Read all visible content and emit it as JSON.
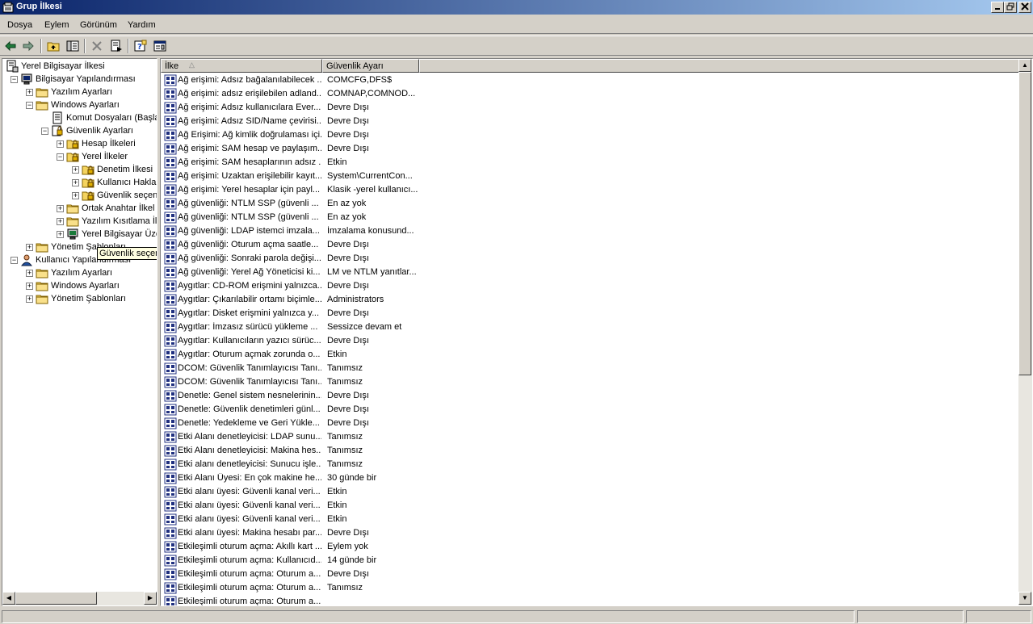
{
  "window": {
    "title": "Grup İlkesi"
  },
  "menu": [
    "Dosya",
    "Eylem",
    "Görünüm",
    "Yardım"
  ],
  "toolbar": [
    "back-arrow-icon",
    "forward-arrow-icon",
    "up-folder-icon",
    "show-hide-tree-icon",
    "delete-icon",
    "export-list-icon",
    "help-icon",
    "properties-icon"
  ],
  "tree": [
    {
      "label": "Yerel Bilgisayar İlkesi",
      "icon": "policy-icon",
      "expander": ""
    },
    {
      "label": "Bilgisayar Yapılandırması",
      "icon": "computer-icon",
      "expander": "−"
    },
    {
      "label": "Yazılım Ayarları",
      "icon": "folder-icon",
      "expander": "+"
    },
    {
      "label": "Windows Ayarları",
      "icon": "folder-icon",
      "expander": "−"
    },
    {
      "label": "Komut Dosyaları (Başla",
      "icon": "script-icon",
      "expander": ""
    },
    {
      "label": "Güvenlik Ayarları",
      "icon": "security-icon",
      "expander": "−"
    },
    {
      "label": "Hesap İlkeleri",
      "icon": "lock-folder-icon",
      "expander": "+"
    },
    {
      "label": "Yerel İlkeler",
      "icon": "lock-folder-icon",
      "expander": "−"
    },
    {
      "label": "Denetim İlkesi",
      "icon": "lock-folder-icon",
      "expander": "+"
    },
    {
      "label": "Kullanıcı Hakları",
      "icon": "lock-folder-icon",
      "expander": "+"
    },
    {
      "label": "Güvenlik seçenekleri",
      "icon": "lock-folder-icon",
      "expander": "+"
    },
    {
      "label": "Ortak Anahtar İlkel",
      "icon": "folder-icon",
      "expander": "+"
    },
    {
      "label": "Yazılım Kısıtlama İlk",
      "icon": "folder-icon",
      "expander": "+"
    },
    {
      "label": "Yerel Bilgisayar Üze",
      "icon": "monitor-icon",
      "expander": "+"
    },
    {
      "label": "Yönetim Şablonları",
      "icon": "folder-icon",
      "expander": "+"
    },
    {
      "label": "Kullanıcı Yapılandırması",
      "icon": "user-icon",
      "expander": "−"
    },
    {
      "label": "Yazılım Ayarları",
      "icon": "folder-icon",
      "expander": "+"
    },
    {
      "label": "Windows Ayarları",
      "icon": "folder-icon",
      "expander": "+"
    },
    {
      "label": "Yönetim Şablonları",
      "icon": "folder-icon",
      "expander": "+"
    }
  ],
  "tooltip": "Güvenlik seçenekleri",
  "list": {
    "columns": [
      "İlke",
      "Güvenlik Ayarı"
    ],
    "sort_indicator": "△",
    "rows": [
      [
        "Ağ erişimi: Adsız bağalanılabilecek ...",
        "COMCFG,DFS$"
      ],
      [
        "Ağ erişimi: adsız erişilebilen adland...",
        "COMNAP,COMNOD..."
      ],
      [
        "Ağ erişimi: Adsız kullanıcılara  Ever...",
        "Devre Dışı"
      ],
      [
        "Ağ erişimi: Adsız SID/Name çevirisi...",
        "Devre Dışı"
      ],
      [
        "Ağ Erişimi: Ağ kimlik doğrulaması içi...",
        "Devre Dışı"
      ],
      [
        "Ağ erişimi: SAM hesap ve paylaşım...",
        "Devre Dışı"
      ],
      [
        "Ağ erişimi: SAM hesaplarının adsız ...",
        "Etkin"
      ],
      [
        "Ağ erişimi: Uzaktan erişilebilir kayıt...",
        "System\\CurrentCon..."
      ],
      [
        "Ağ erişimi: Yerel hesaplar için payl...",
        "Klasik -yerel kullanıcı..."
      ],
      [
        "Ağ güvenliği:  NTLM SSP  (güvenli ...",
        "En az yok"
      ],
      [
        "Ağ güvenliği:  NTLM SSP  (güvenli ...",
        "En az yok"
      ],
      [
        "Ağ güvenliği: LDAP istemci imzala...",
        "İmzalama konusund..."
      ],
      [
        "Ağ güvenliği: Oturum açma saatle...",
        "Devre Dışı"
      ],
      [
        "Ağ güvenliği: Sonraki parola değişi...",
        "Devre Dışı"
      ],
      [
        "Ağ güvenliği: Yerel Ağ Yöneticisi ki...",
        "LM ve NTLM yanıtlar..."
      ],
      [
        "Aygıtlar: CD-ROM erişmini yalnızca...",
        "Devre Dışı"
      ],
      [
        "Aygıtlar: Çıkarılabilir ortamı biçimle...",
        "Administrators"
      ],
      [
        "Aygıtlar: Disket erişmini yalnızca y...",
        "Devre Dışı"
      ],
      [
        "Aygıtlar: İmzasız sürücü yükleme ...",
        "Sessizce devam et"
      ],
      [
        "Aygıtlar: Kullanıcıların yazıcı sürüc...",
        "Devre Dışı"
      ],
      [
        "Aygıtlar: Oturum açmak zorunda o...",
        "Etkin"
      ],
      [
        "DCOM: Güvenlik Tanımlayıcısı Tanı...",
        "Tanımsız"
      ],
      [
        "DCOM: Güvenlik Tanımlayıcısı Tanı...",
        "Tanımsız"
      ],
      [
        "Denetle: Genel sistem nesnelerinin...",
        "Devre Dışı"
      ],
      [
        "Denetle: Güvenlik denetimleri günl...",
        "Devre Dışı"
      ],
      [
        "Denetle: Yedekleme ve Geri Yükle...",
        "Devre Dışı"
      ],
      [
        "Etki Alanı denetleyicisi: LDAP sunu...",
        "Tanımsız"
      ],
      [
        "Etki Alanı denetleyicisi: Makina hes...",
        "Tanımsız"
      ],
      [
        "Etki alanı denetleyicisi: Sunucu işle...",
        "Tanımsız"
      ],
      [
        "Etki Alanı Üyesi: En çok makine he...",
        "30 günde bir"
      ],
      [
        "Etki alanı üyesi: Güvenli kanal veri...",
        "Etkin"
      ],
      [
        "Etki alanı üyesi: Güvenli kanal veri...",
        "Etkin"
      ],
      [
        "Etki alanı üyesi: Güvenli kanal veri...",
        "Etkin"
      ],
      [
        "Etki alanı üyesi: Makina hesabı par...",
        "Devre Dışı"
      ],
      [
        "Etkileşimli  oturum açma: Akıllı kart ...",
        "Eylem yok"
      ],
      [
        "Etkileşimli  oturum açma: Kullanıcıd...",
        "14 günde bir"
      ],
      [
        "Etkileşimli  oturum açma: Oturum a...",
        "Devre Dışı"
      ],
      [
        "Etkileşimli  oturum açma: Oturum a...",
        "Tanımsız"
      ],
      [
        "Etkileşimli  oturum açma: Oturum a...",
        ""
      ]
    ]
  },
  "colors": {
    "titlebar_start": "#0a246a",
    "titlebar_end": "#a6caf0",
    "face": "#d4d0c8",
    "tooltip": "#ffffe1"
  }
}
